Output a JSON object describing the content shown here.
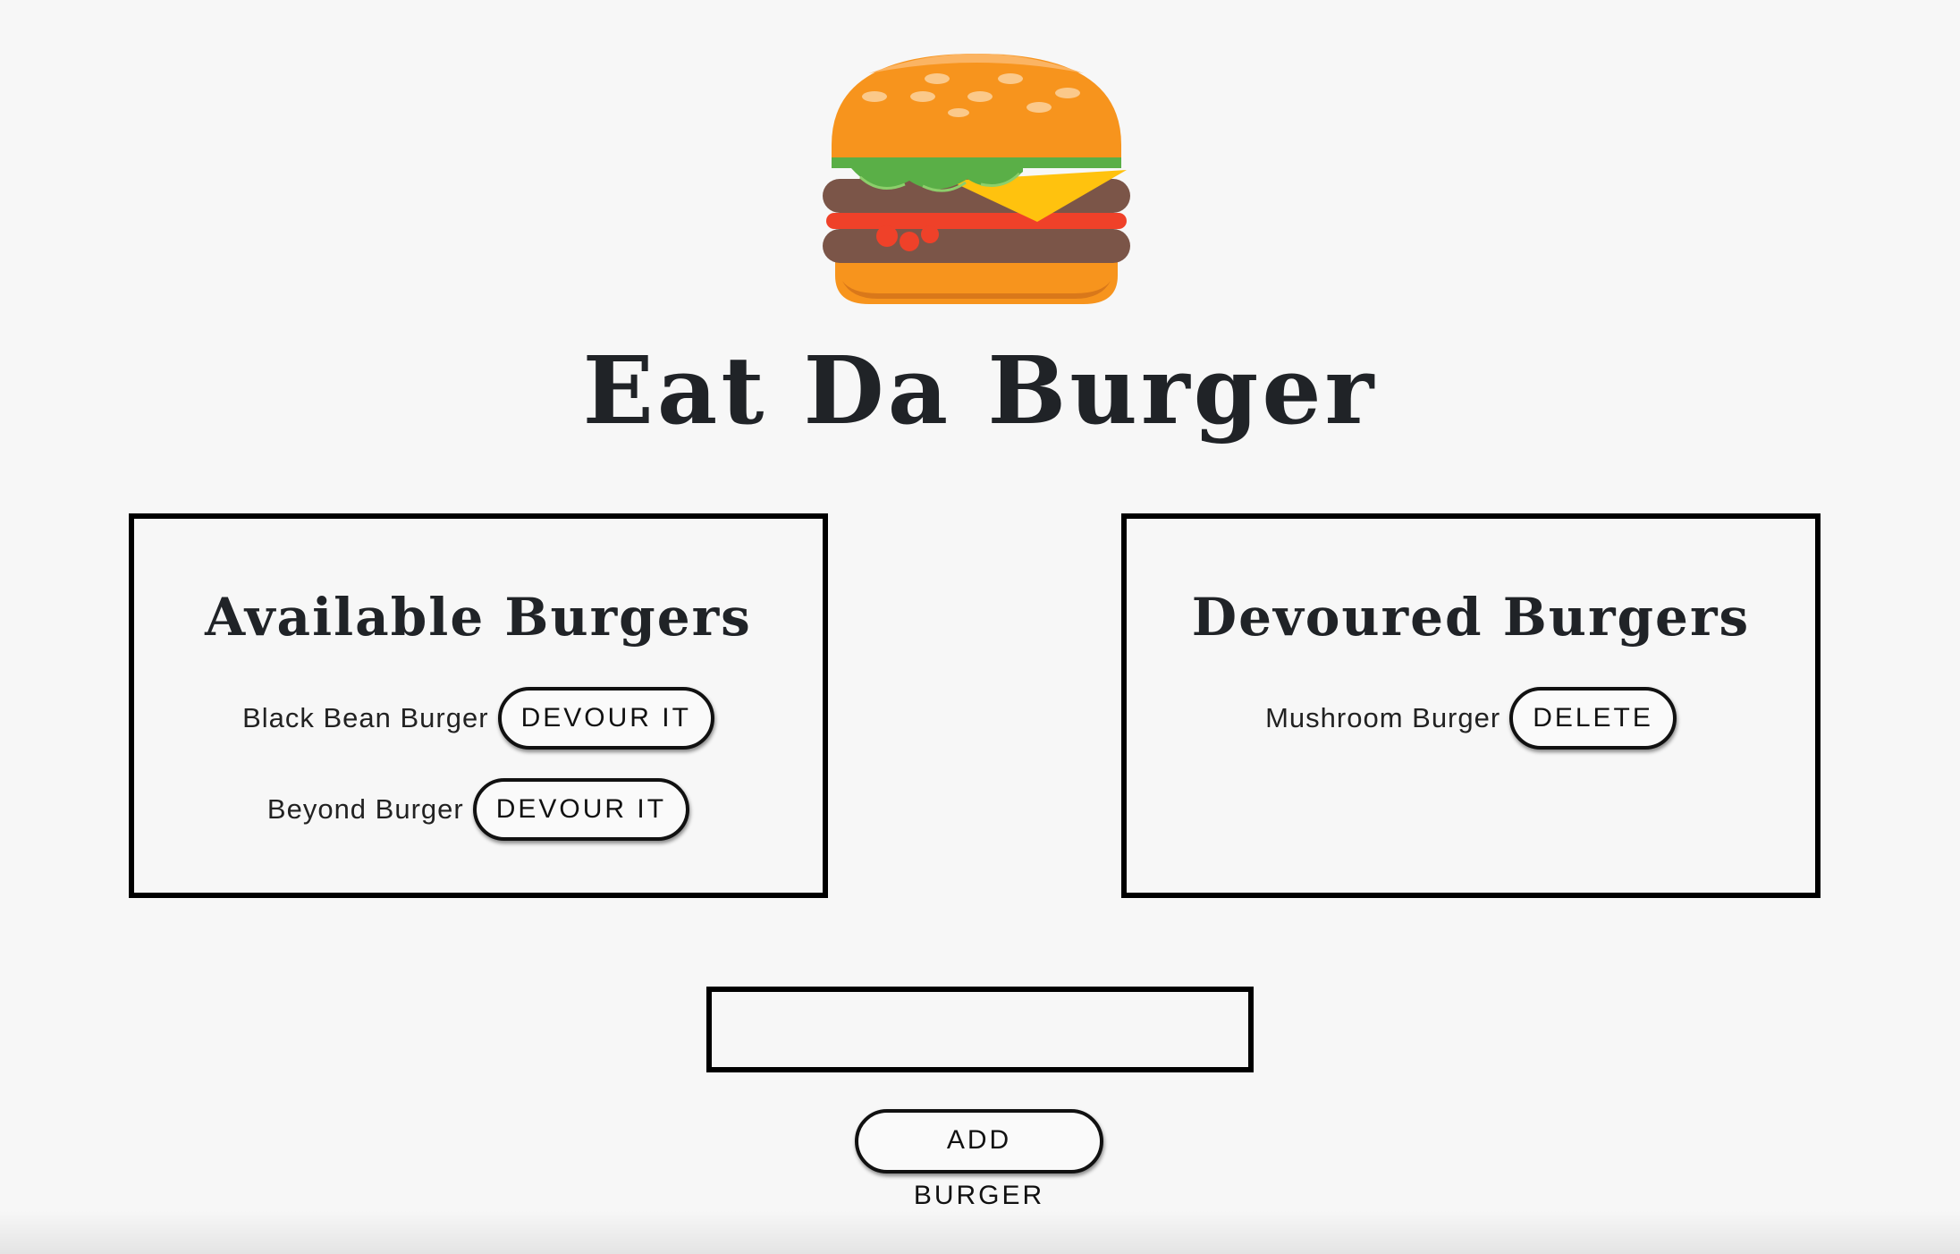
{
  "header": {
    "logo_icon": "hamburger-logo-icon",
    "title": "Eat Da Burger"
  },
  "available": {
    "heading": "Available Burgers",
    "items": [
      {
        "name": "Black Bean Burger",
        "action_label": "DEVOUR IT"
      },
      {
        "name": "Beyond Burger",
        "action_label": "DEVOUR IT"
      }
    ]
  },
  "devoured": {
    "heading": "Devoured Burgers",
    "items": [
      {
        "name": "Mushroom Burger",
        "action_label": "DELETE"
      }
    ]
  },
  "form": {
    "input_value": "",
    "add_label": "ADD BURGER"
  },
  "colors": {
    "background": "#f7f7f7",
    "border": "#000000",
    "text": "#202327",
    "bun": "#f7941d",
    "lettuce": "#5aaf47",
    "cheese": "#ffc20e",
    "tomato": "#ef4129",
    "patty": "#7b5548"
  }
}
